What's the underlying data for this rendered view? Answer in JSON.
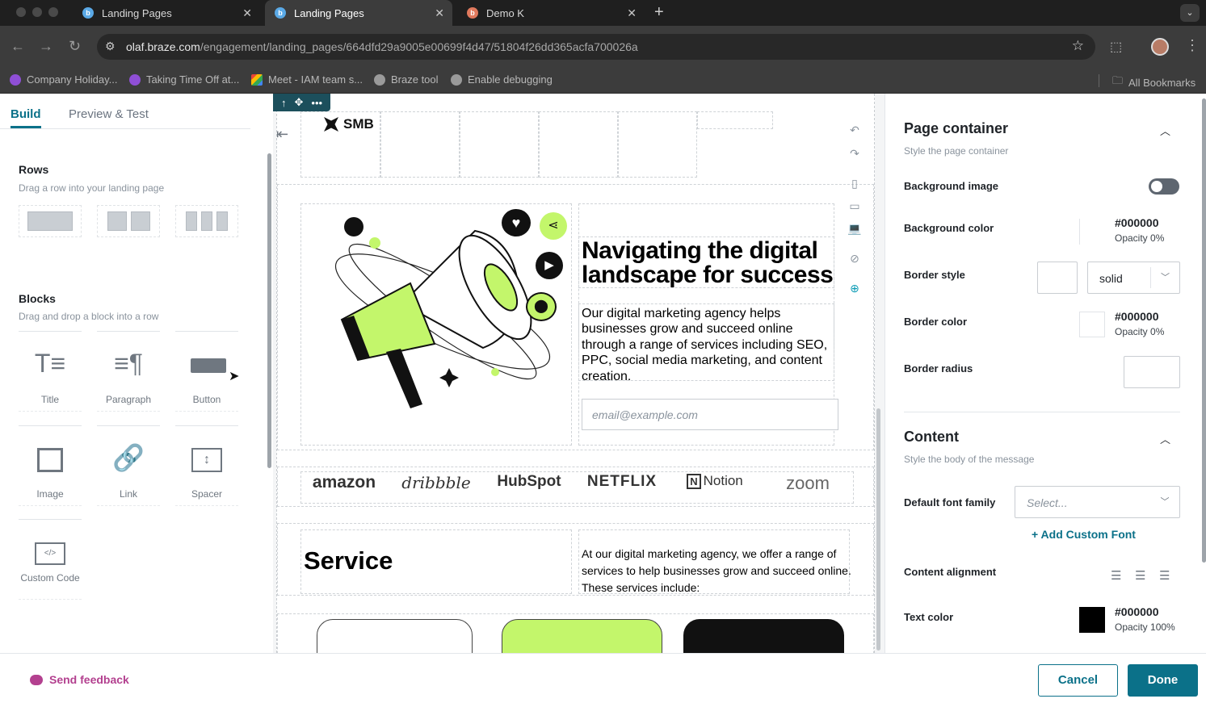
{
  "browser": {
    "tabs": [
      {
        "title": "Landing Pages",
        "favicon": "braze-icon"
      },
      {
        "title": "Landing Pages",
        "favicon": "braze-icon",
        "active": true
      },
      {
        "title": "Demo K",
        "favicon": "demo-icon"
      }
    ],
    "url_host": "olaf.braze.com",
    "url_path": "/engagement/landing_pages/664dfd29a9005e00699f4d47/51804f26dd365acfa700026a",
    "bookmarks": [
      "Company Holiday...",
      "Taking Time Off at...",
      "Meet - IAM team s...",
      "Braze tool",
      "Enable debugging"
    ],
    "all_bookmarks": "All Bookmarks"
  },
  "left_panel": {
    "tabs": [
      "Build",
      "Preview & Test"
    ],
    "rows": {
      "title": "Rows",
      "subtitle": "Drag a row into your landing page"
    },
    "blocks": {
      "title": "Blocks",
      "subtitle": "Drag and drop a block into a row",
      "items": [
        {
          "label": "Title",
          "icon": "title-icon"
        },
        {
          "label": "Paragraph",
          "icon": "paragraph-icon"
        },
        {
          "label": "Button",
          "icon": "button-icon"
        },
        {
          "label": "Image",
          "icon": "image-icon"
        },
        {
          "label": "Link",
          "icon": "link-icon"
        },
        {
          "label": "Spacer",
          "icon": "spacer-icon"
        },
        {
          "label": "Custom Code",
          "icon": "code-icon"
        }
      ]
    }
  },
  "canvas": {
    "logo_text": "SMB",
    "hero": {
      "title": "Navigating the digital landscape for success",
      "body": "Our digital marketing agency helps businesses grow and succeed online through a range of services including SEO, PPC, social media marketing, and content creation.",
      "email_placeholder": "email@example.com"
    },
    "brands": [
      "amazon",
      "dribbble",
      "HubSpot",
      "NETFLIX",
      "Notion",
      "zoom"
    ],
    "service": {
      "title": "Service",
      "body": "At our digital marketing agency, we offer a range of services to help businesses grow and succeed online. These services include:"
    },
    "accent_color": "#c3f66b"
  },
  "right_panel": {
    "page_container": {
      "title": "Page container",
      "subtitle": "Style the page container",
      "background_image_label": "Background image",
      "background_image_enabled": false,
      "background_color_label": "Background color",
      "background_color": "#000000",
      "background_opacity": "Opacity 0%",
      "border_style_label": "Border style",
      "border_style": "solid",
      "border_color_label": "Border color",
      "border_color": "#000000",
      "border_opacity": "Opacity 0%",
      "border_radius_label": "Border radius"
    },
    "content": {
      "title": "Content",
      "subtitle": "Style the body of the message",
      "font_family_label": "Default font family",
      "font_family_placeholder": "Select...",
      "add_custom_font": "+ Add Custom Font",
      "alignment_label": "Content alignment",
      "text_color_label": "Text color",
      "text_color": "#000000",
      "text_opacity": "Opacity 100%"
    }
  },
  "footer": {
    "feedback": "Send feedback",
    "cancel": "Cancel",
    "done": "Done"
  },
  "colors": {
    "primary": "#0b7189",
    "feedback": "#b3408f"
  }
}
